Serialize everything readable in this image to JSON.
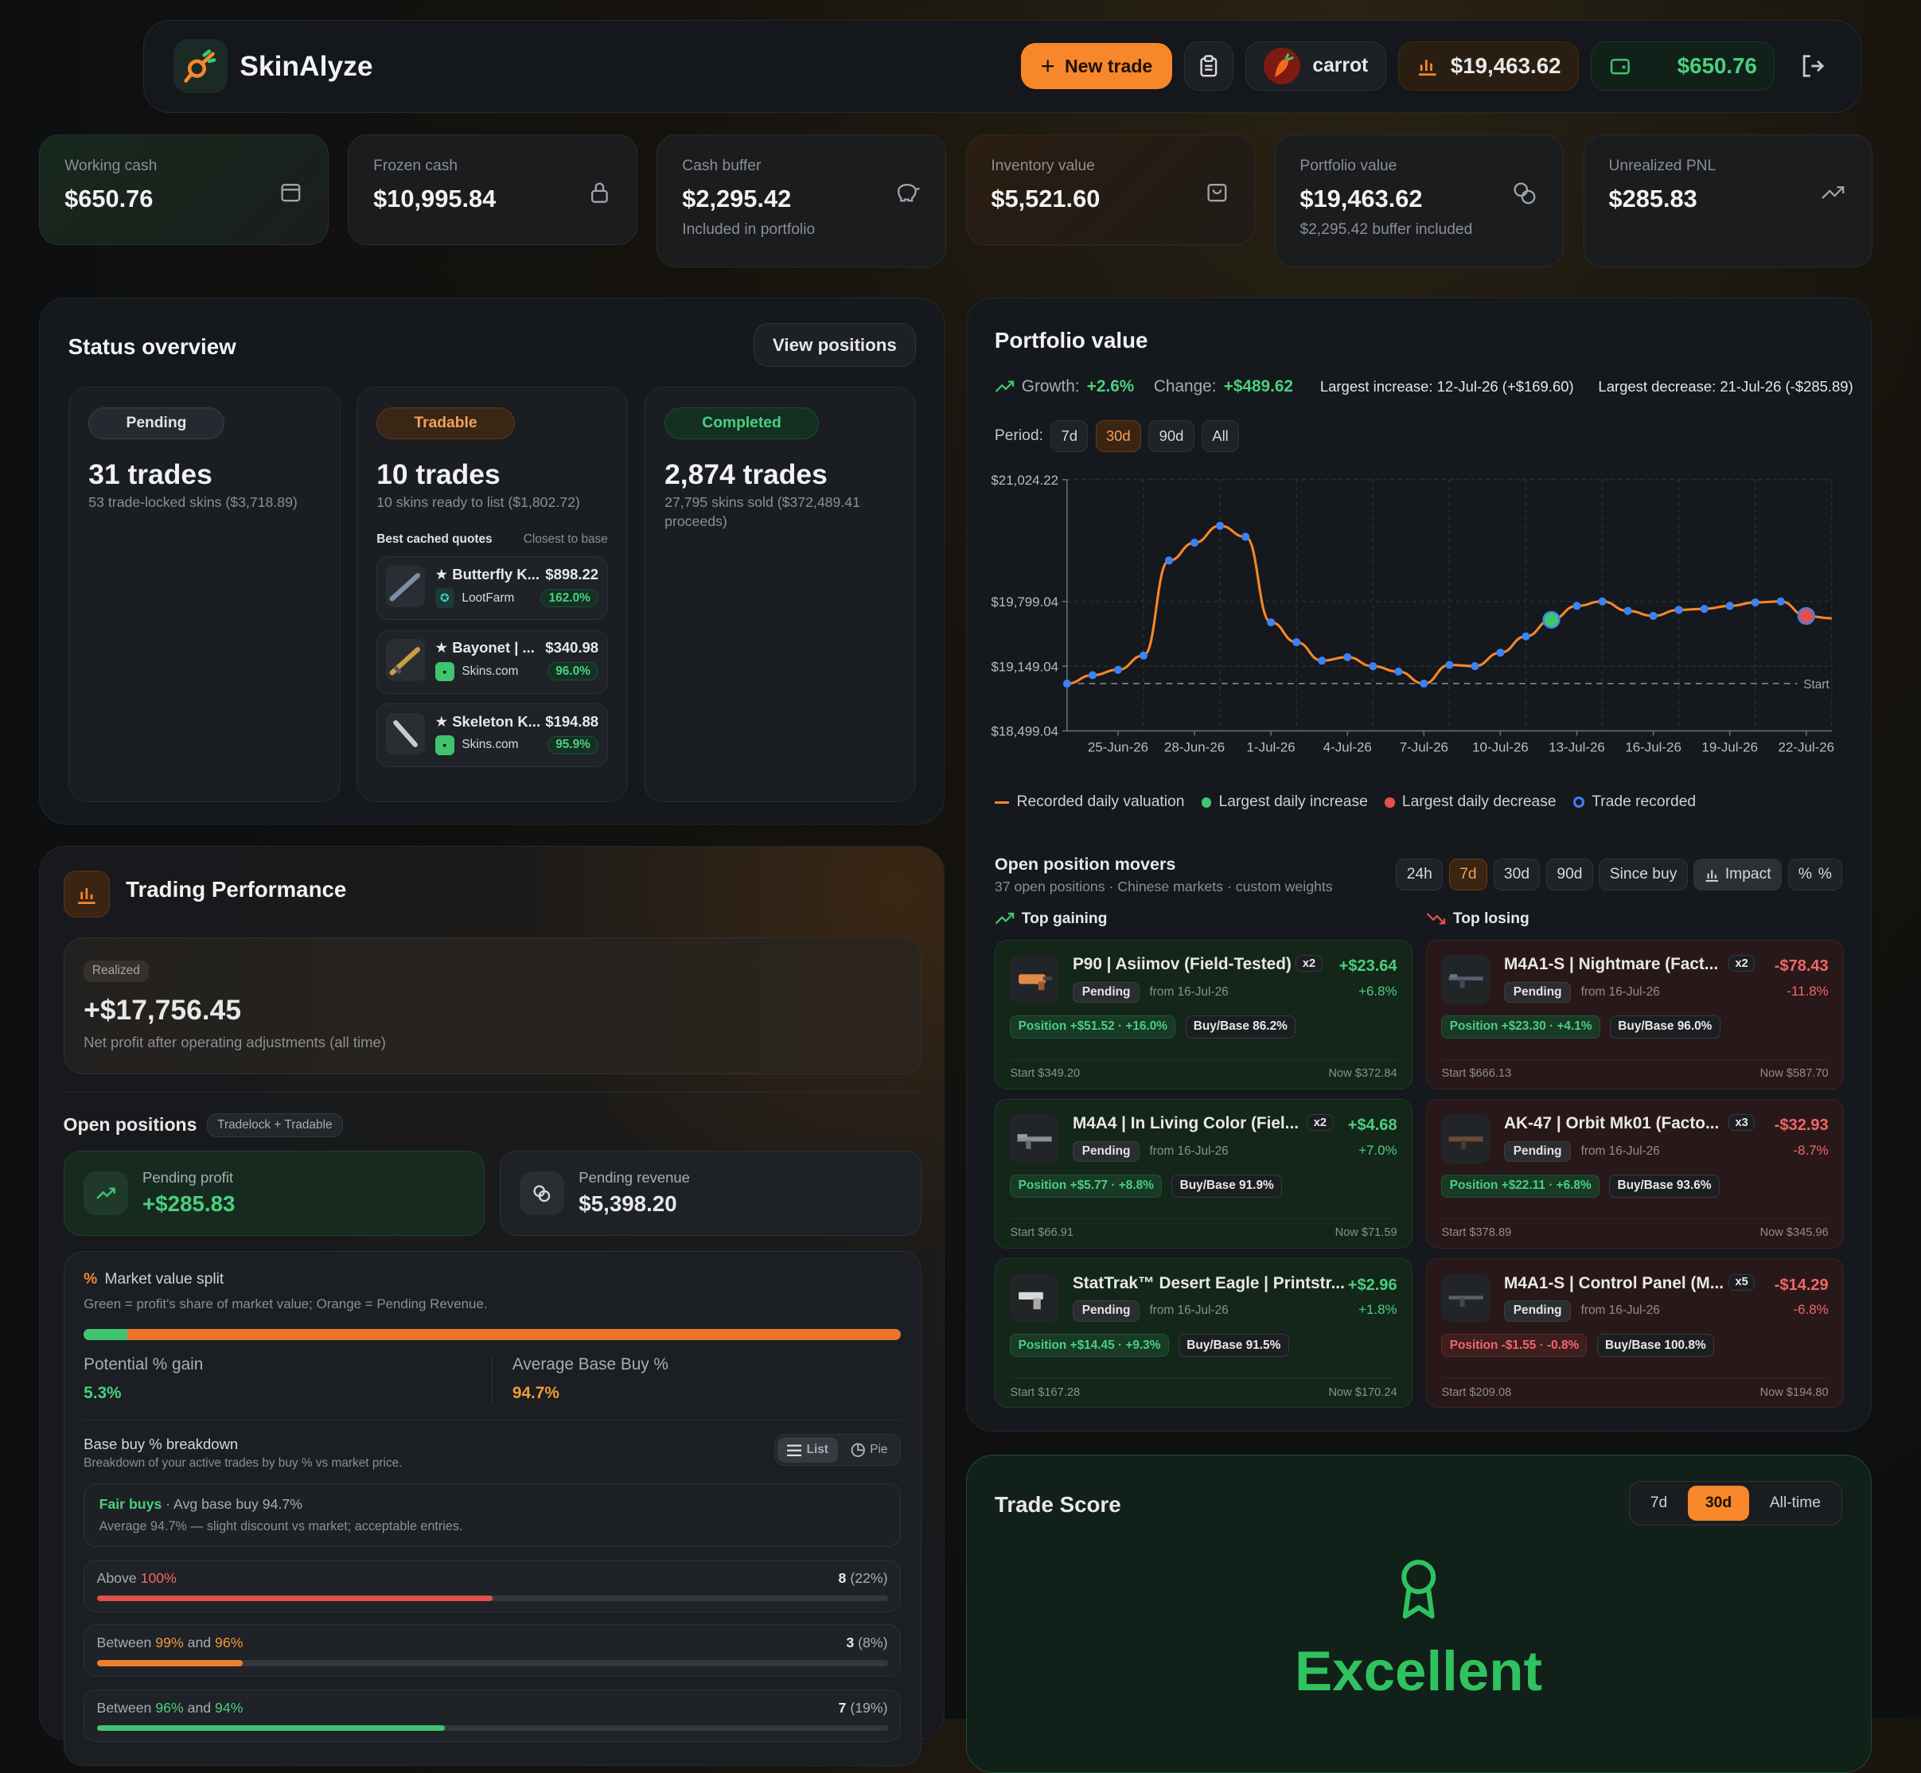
{
  "app": {
    "name": "SkinAlyze"
  },
  "header": {
    "new_trade": "New trade",
    "username": "carrot",
    "portfolio_total": "$19,463.62",
    "wallet_total": "$650.76"
  },
  "stats": [
    {
      "label": "Working cash",
      "value": "$650.76",
      "sub": "",
      "icon": "wallet-icon"
    },
    {
      "label": "Frozen cash",
      "value": "$10,995.84",
      "sub": "",
      "icon": "lock-icon"
    },
    {
      "label": "Cash buffer",
      "value": "$2,295.42",
      "sub": "Included in portfolio",
      "icon": "piggy-bank-icon"
    },
    {
      "label": "Inventory value",
      "value": "$5,521.60",
      "sub": "",
      "icon": "bag-icon"
    },
    {
      "label": "Portfolio value",
      "value": "$19,463.62",
      "sub": "$2,295.42 buffer included",
      "icon": "coins-icon"
    },
    {
      "label": "Unrealized PNL",
      "value": "$285.83",
      "sub": "",
      "icon": "trend-up-icon"
    }
  ],
  "status": {
    "title": "Status overview",
    "view_button": "View positions",
    "pending": {
      "badge": "Pending",
      "count": "31 trades",
      "sub": "53 trade-locked skins ($3,718.89)"
    },
    "tradable": {
      "badge": "Tradable",
      "count": "10 trades",
      "sub": "10 skins ready to list ($1,802.72)",
      "quotes_title": "Best cached quotes",
      "quotes_hint": "Closest to base",
      "quotes": [
        {
          "name": "★ Butterfly K...",
          "price": "$898.22",
          "market": "LootFarm",
          "pct": "162.0%"
        },
        {
          "name": "★ Bayonet | ...",
          "price": "$340.98",
          "market": "Skins.com",
          "pct": "96.0%"
        },
        {
          "name": "★ Skeleton K...",
          "price": "$194.88",
          "market": "Skins.com",
          "pct": "95.9%"
        }
      ]
    },
    "completed": {
      "badge": "Completed",
      "count": "2,874 trades",
      "sub": "27,795 skins sold ($372,489.41 proceeds)"
    }
  },
  "performance": {
    "title": "Trading Performance",
    "realized_badge": "Realized",
    "realized_value": "+$17,756.45",
    "realized_sub": "Net profit after operating adjustments (all time)",
    "open_title": "Open positions",
    "open_badge": "Tradelock + Tradable",
    "pending_profit_label": "Pending profit",
    "pending_profit_value": "+$285.83",
    "pending_revenue_label": "Pending revenue",
    "pending_revenue_value": "$5,398.20",
    "split_title": "Market value split",
    "split_sub": "Green = profit's share of market value; Orange = Pending Revenue.",
    "split_green_fraction": 0.053,
    "potential_label": "Potential % gain",
    "potential_value": "5.3%",
    "avg_label": "Average Base Buy %",
    "avg_value": "94.7%",
    "breakdown_title": "Base buy % breakdown",
    "breakdown_sub": "Breakdown of your active trades by buy % vs market price.",
    "toggle_list": "List",
    "toggle_pie": "Pie",
    "fair_title": "Fair buys",
    "fair_avg": " · Avg base buy 94.7%",
    "fair_desc": "Average 94.7% — slight discount vs market; acceptable entries.",
    "rows": [
      {
        "pre": "Above ",
        "a": "100%",
        "mid": "",
        "b": "",
        "count": "8",
        "share": "(22%)",
        "fill": 0.5,
        "color": "#e24f4f",
        "ca": "#f26767",
        "cb": ""
      },
      {
        "pre": "Between ",
        "a": "99%",
        "mid": " and ",
        "b": "96%",
        "count": "3",
        "share": "(8%)",
        "fill": 0.185,
        "color": "#ee7f2c",
        "ca": "#f39a3b",
        "cb": "#f39a3b"
      },
      {
        "pre": "Between ",
        "a": "96%",
        "mid": " and ",
        "b": "94%",
        "count": "7",
        "share": "(19%)",
        "fill": 0.44,
        "color": "#3fc46f",
        "ca": "#4ad07f",
        "cb": "#4ad07f"
      }
    ]
  },
  "portfolio": {
    "title": "Portfolio value",
    "growth_label": "Growth:",
    "growth_value": "+2.6%",
    "change_label": "Change:",
    "change_value": "+$489.62",
    "largest_increase": "Largest increase: 12-Jul-26 (+$169.60)",
    "largest_decrease": "Largest decrease: 21-Jul-26 (-$285.89)",
    "period_label": "Period:",
    "periods": [
      "7d",
      "30d",
      "90d",
      "All"
    ],
    "active_period": "30d",
    "legend": [
      "Recorded daily valuation",
      "Largest daily increase",
      "Largest daily decrease",
      "Trade recorded"
    ],
    "colors": {
      "line": "#f7872a",
      "point": "#3b82f6",
      "increase": "#3fc46f",
      "decrease": "#e24f4f"
    }
  },
  "chart_data": {
    "type": "line",
    "y_ticks": [
      "$21,024.22",
      "$19,799.04",
      "$19,149.04",
      "$18,499.04"
    ],
    "y_tick_values": [
      21024.22,
      19799.04,
      19149.04,
      18499.04
    ],
    "x_ticks": [
      "25-Jun-26",
      "28-Jun-26",
      "1-Jul-26",
      "4-Jul-26",
      "7-Jul-26",
      "10-Jul-26",
      "13-Jul-26",
      "16-Jul-26",
      "19-Jul-26",
      "22-Jul-26"
    ],
    "baseline_label": "Start",
    "baseline": 18974,
    "ylim": [
      18499.04,
      21024.22
    ],
    "series": [
      {
        "values": [
          18974,
          19059,
          19113,
          19256,
          20211,
          20390,
          20560,
          20450,
          19590,
          19390,
          19205,
          19240,
          19149,
          19095,
          18974,
          19162,
          19150,
          19285,
          19449,
          19615,
          19755,
          19800,
          19705,
          19655,
          19715,
          19725,
          19755,
          19790,
          19800,
          19654,
          19630
        ]
      }
    ],
    "x_start": "23-Jun-26",
    "largest_increase_date": "12-Jul-26",
    "largest_decrease_date": "21-Jul-26"
  },
  "movers": {
    "title": "Open position movers",
    "sub": "37 open positions · Chinese markets · custom weights",
    "filters": [
      "24h",
      "7d",
      "30d",
      "90d",
      "Since buy",
      "Impact",
      "%"
    ],
    "active_filter": "7d",
    "gaining_title": "Top gaining",
    "losing_title": "Top losing",
    "gaining": [
      {
        "name": "P90 | Asiimov (Field-Tested)",
        "qty": "x2",
        "amt": "+$23.64",
        "pct": "+6.8%",
        "status": "Pending",
        "from": "from 16-Jul-26",
        "position": "Position +$51.52 · +16.0%",
        "base": "Buy/Base 86.2%",
        "start": "Start $349.20",
        "now": "Now $372.84"
      },
      {
        "name": "M4A4 | In Living Color (Fiel...",
        "qty": "x2",
        "amt": "+$4.68",
        "pct": "+7.0%",
        "status": "Pending",
        "from": "from 16-Jul-26",
        "position": "Position +$5.77 · +8.8%",
        "base": "Buy/Base 91.9%",
        "start": "Start $66.91",
        "now": "Now $71.59"
      },
      {
        "name": "StatTrak™ Desert Eagle | Printstr...",
        "qty": "",
        "amt": "+$2.96",
        "pct": "+1.8%",
        "status": "Pending",
        "from": "from 16-Jul-26",
        "position": "Position +$14.45 · +9.3%",
        "base": "Buy/Base 91.5%",
        "start": "Start $167.28",
        "now": "Now $170.24"
      }
    ],
    "losing": [
      {
        "name": "M4A1-S | Nightmare (Fact...",
        "qty": "x2",
        "amt": "-$78.43",
        "pct": "-11.8%",
        "status": "Pending",
        "from": "from 16-Jul-26",
        "position": "Position +$23.30 · +4.1%",
        "base": "Buy/Base 96.0%",
        "start": "Start $666.13",
        "now": "Now $587.70"
      },
      {
        "name": "AK-47 | Orbit Mk01 (Facto...",
        "qty": "x3",
        "amt": "-$32.93",
        "pct": "-8.7%",
        "status": "Pending",
        "from": "from 16-Jul-26",
        "position": "Position +$22.11 · +6.8%",
        "base": "Buy/Base 93.6%",
        "start": "Start $378.89",
        "now": "Now $345.96"
      },
      {
        "name": "M4A1-S | Control Panel (M...",
        "qty": "x5",
        "amt": "-$14.29",
        "pct": "-6.8%",
        "status": "Pending",
        "from": "from 16-Jul-26",
        "position": "Position -$1.55 · -0.8%",
        "base": "Buy/Base 100.8%",
        "start": "Start $209.08",
        "now": "Now $194.80"
      }
    ]
  },
  "trade_score": {
    "title": "Trade Score",
    "periods": [
      "7d",
      "30d",
      "All-time"
    ],
    "active": "30d",
    "rating": "Excellent"
  }
}
